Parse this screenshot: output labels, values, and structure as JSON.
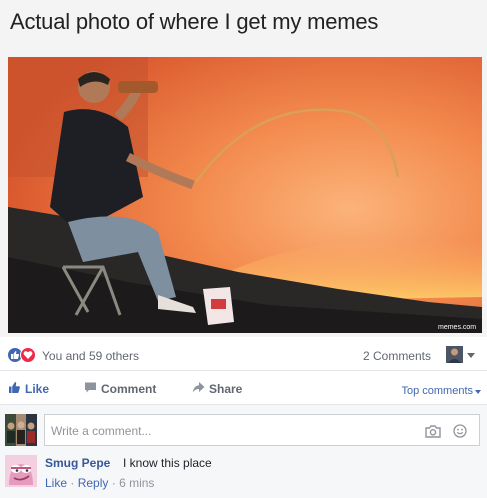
{
  "meme": {
    "caption": "Actual photo of where I get my memes",
    "watermark": "memes.com"
  },
  "reactions": {
    "summary": "You and 59 others",
    "comments_count": "2 Comments"
  },
  "actions": {
    "like": "Like",
    "comment": "Comment",
    "share": "Share",
    "sort": "Top comments"
  },
  "composer": {
    "placeholder": "Write a comment..."
  },
  "comments": [
    {
      "author": "Smug Pepe",
      "text": "I know this place",
      "like": "Like",
      "reply": "Reply",
      "time": "6 mins"
    }
  ],
  "colors": {
    "facebook_blue": "#4267b2",
    "link_blue": "#365899",
    "love_red": "#f0284a",
    "lava_orange": "#f07a3a"
  },
  "icons": [
    "like-reaction-icon",
    "love-reaction-icon",
    "thumbs-up-icon",
    "comment-icon",
    "share-icon",
    "camera-icon",
    "emoji-icon"
  ]
}
